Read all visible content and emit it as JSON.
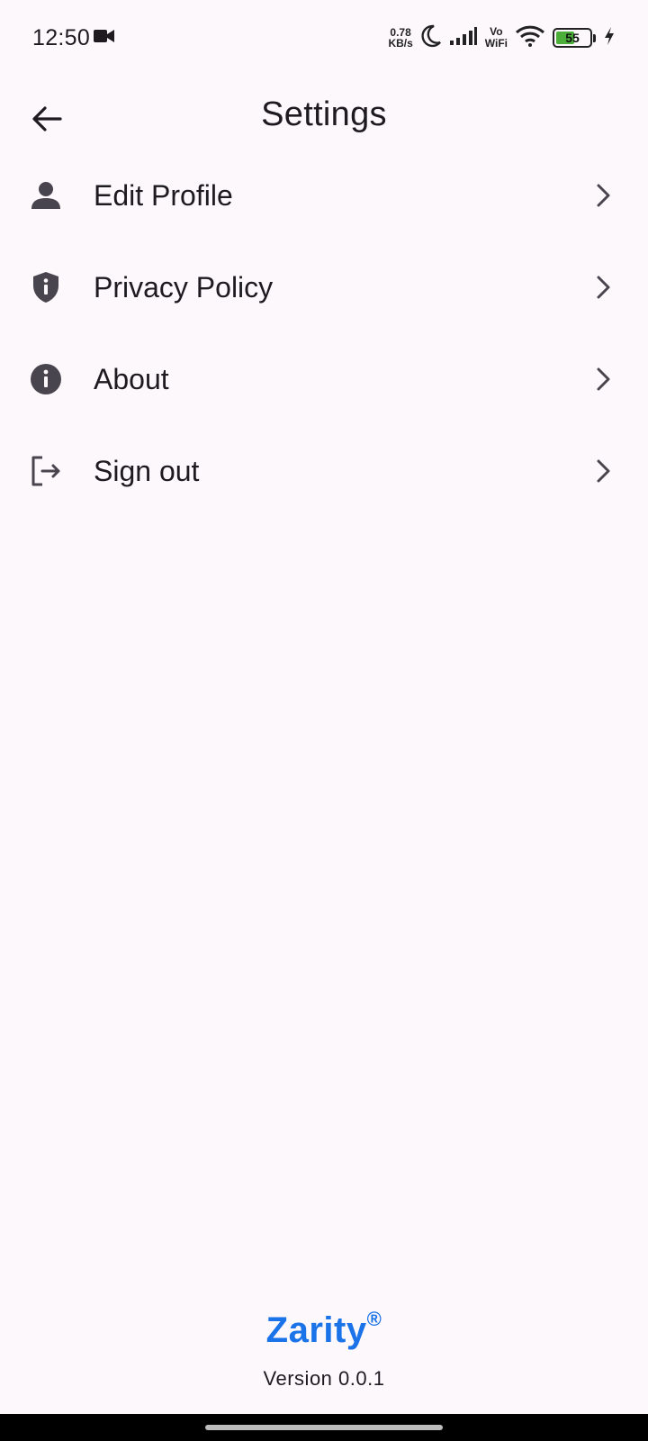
{
  "status_bar": {
    "time": "12:50",
    "net_speed_value": "0.78",
    "net_speed_unit": "KB/s",
    "vowifi_top": "Vo",
    "vowifi_bottom": "WiFi",
    "battery_level": "55",
    "battery_fraction": 0.55,
    "icons": [
      "video-camera-icon",
      "moon-icon",
      "signal-icon",
      "wifi-icon",
      "battery-icon",
      "charging-bolt-icon"
    ]
  },
  "app_bar": {
    "title": "Settings",
    "back_icon": "arrow-left-icon"
  },
  "menu": {
    "items": [
      {
        "label": "Edit Profile",
        "icon": "person-icon"
      },
      {
        "label": "Privacy Policy",
        "icon": "shield-icon"
      },
      {
        "label": "About",
        "icon": "info-icon"
      },
      {
        "label": "Sign out",
        "icon": "logout-icon"
      }
    ],
    "chevron_icon": "chevron-right-icon"
  },
  "footer": {
    "brand": "Zarity",
    "brand_mark": "®",
    "version": "Version 0.0.1"
  },
  "colors": {
    "background": "#fdf8fc",
    "text": "#1d1b20",
    "icon": "#49454f",
    "brand": "#1a73e8",
    "battery_fill": "#4caf3a"
  }
}
